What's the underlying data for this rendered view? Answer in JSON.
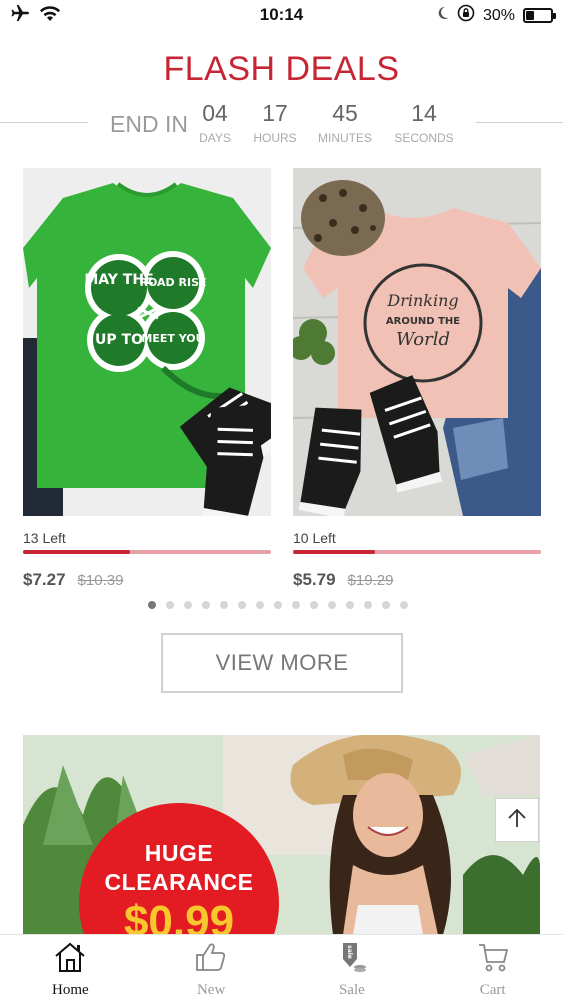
{
  "status_bar": {
    "time": "10:14",
    "battery": "30%",
    "battery_level": 0.3
  },
  "flash_deals": {
    "title": "FLASH DEALS",
    "end_in": "END IN",
    "countdown": [
      {
        "value": "04",
        "label": "DAYS"
      },
      {
        "value": "17",
        "label": "HOURS"
      },
      {
        "value": "45",
        "label": "MINUTES"
      },
      {
        "value": "14",
        "label": "SECONDS"
      }
    ]
  },
  "products": [
    {
      "image": "green shamrock t-shirt",
      "shirt_text": [
        "MAY THE",
        "ROAD RISE",
        "UP TO",
        "MEET YOU"
      ],
      "stock_text": "13 Left",
      "stock_level": 0.43,
      "price": "$7.27",
      "old_price": "$10.39"
    },
    {
      "image": "pink drinking around the world t-shirt",
      "shirt_text": [
        "Drinking",
        "AROUND THE",
        "World"
      ],
      "stock_text": "10 Left",
      "stock_level": 0.33,
      "price": "$5.79",
      "old_price": "$19.29"
    }
  ],
  "pager": {
    "count": 15,
    "active": 0
  },
  "view_more": "VIEW MORE",
  "banner": {
    "line1": "HUGE",
    "line2": "CLEARANCE",
    "price": "$0.99"
  },
  "tabs": [
    {
      "label": "Home",
      "icon": "home-icon",
      "active": true
    },
    {
      "label": "New",
      "icon": "thumbs-up-icon",
      "active": false
    },
    {
      "label": "Sale",
      "icon": "sale-tag-icon",
      "active": false
    },
    {
      "label": "Cart",
      "icon": "cart-icon",
      "active": false
    }
  ],
  "colors": {
    "accent": "#c62634",
    "stock_track": "#e8a0a7",
    "clearance_red": "#e31b23",
    "clearance_price": "#f7c72d"
  }
}
